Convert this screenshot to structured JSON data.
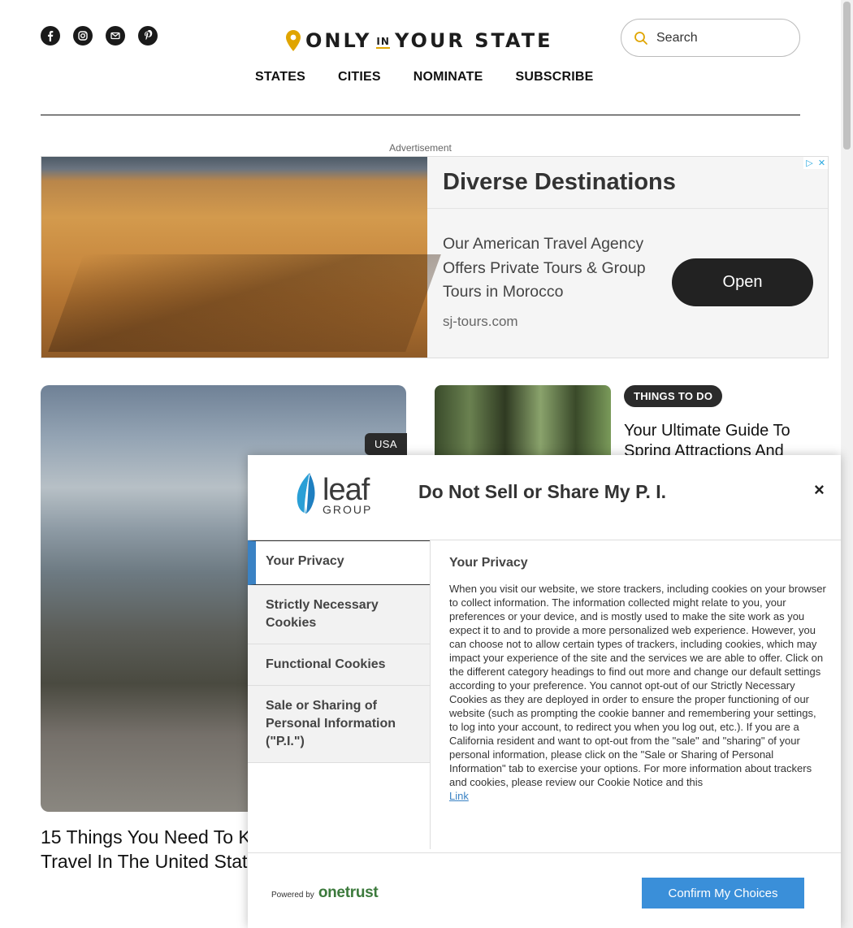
{
  "header": {
    "social": [
      {
        "name": "facebook-icon"
      },
      {
        "name": "instagram-icon"
      },
      {
        "name": "email-icon"
      },
      {
        "name": "pinterest-icon"
      }
    ],
    "logo": {
      "only": "ONLY",
      "in": "IN",
      "rest": "YOUR STATE"
    },
    "search": {
      "placeholder": "Search"
    },
    "nav": [
      "STATES",
      "CITIES",
      "NOMINATE",
      "SUBSCRIBE"
    ]
  },
  "ad": {
    "label": "Advertisement",
    "headline": "Diverse Destinations",
    "body": "Our American Travel Agency Offers Private Tours & Group Tours in Morocco",
    "url": "sj-tours.com",
    "cta": "Open"
  },
  "articles": {
    "big": {
      "badge": "USA",
      "title": "15 Things You Need To Know Before You Solo Travel In The United States"
    },
    "small": {
      "badge": "THINGS TO DO",
      "title": "Your Ultimate Guide To Spring Attractions And Events"
    }
  },
  "modal": {
    "logo_main": "leaf",
    "logo_sub": "GROUP",
    "title": "Do Not Sell or Share My P. I.",
    "close": "×",
    "tabs": [
      "Your Privacy",
      "Strictly Necessary Cookies",
      "Functional Cookies",
      "Sale or Sharing of Personal Information (\"P.I.\")"
    ],
    "pane": {
      "heading": "Your Privacy",
      "text": "When you visit our website, we store trackers, including cookies on your browser to collect information. The information collected might relate to you, your preferences or your device, and is mostly used to make the site work as you expect it to and to provide a more personalized web experience. However, you can choose not to allow certain types of trackers, including cookies, which may impact your experience of the site and the services we are able to offer. Click on the different category headings to find out more and change our default settings according to your preference. You cannot opt-out of our Strictly Necessary Cookies as they are deployed in order to ensure the proper functioning of our website (such as prompting the cookie banner and remembering your settings, to log into your account, to redirect you when you log out, etc.). If you are a California resident and want to opt-out from the \"sale\" and \"sharing\" of your personal information, please click on the \"Sale or Sharing of Personal Information\" tab to exercise your options. For more information about trackers and cookies, please review our Cookie Notice and this",
      "link": "Link"
    },
    "footer": {
      "powered": "Powered by",
      "brand": "onetrust",
      "confirm": "Confirm My Choices"
    }
  },
  "colors": {
    "accent": "#3a8fd9",
    "tab_active_bar": "#3a82c4",
    "logo_pin": "#e0a500"
  }
}
